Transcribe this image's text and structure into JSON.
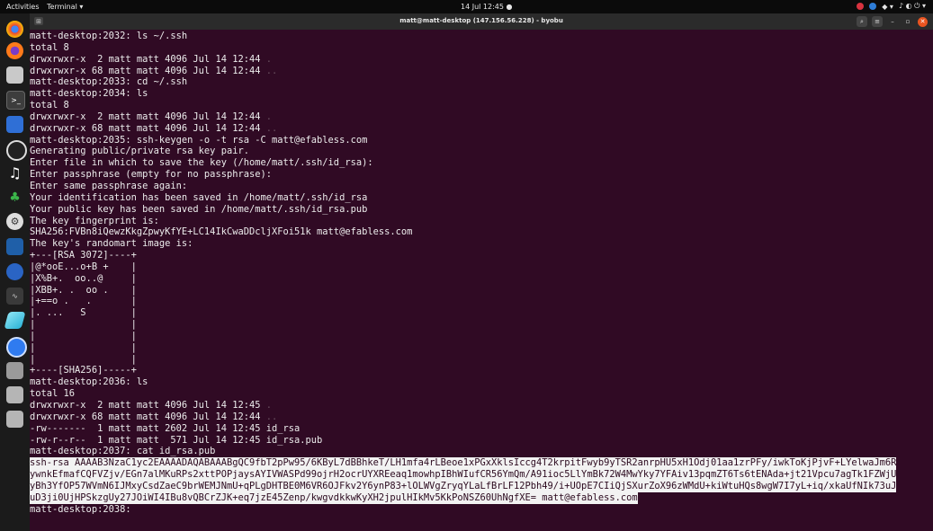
{
  "topbar": {
    "activities": "Activities",
    "app_menu": "Terminal ▾",
    "clock": "14 Jul  12:45  ●",
    "status": [
      "▾",
      "⚲",
      "◆ ▾",
      "♪ ◐ ⏻ ▾"
    ]
  },
  "window": {
    "title": "matt@matt-desktop (147.156.56.228) - byobu",
    "new_tab": "⊞",
    "search": "⌕",
    "menu": "≡",
    "minimize": "–",
    "maximize": "▫",
    "close": "✕"
  },
  "dock": {
    "items": [
      "chrome-icon",
      "firefox-icon",
      "files-icon",
      "terminal-icon",
      "screenshot-icon",
      "obs-icon",
      "music-icon",
      "plant-icon",
      "settings-icon",
      "vscode-icon",
      "davinci-icon",
      "monitor-icon",
      "eraser-icon",
      "circle-app-icon",
      "drive-icon",
      "usb-icon",
      "usb-icon-2"
    ]
  },
  "terminal": {
    "lines": [
      "matt-desktop:2032: ls ~/.ssh",
      "total 8",
      "drwxrwxr-x  2 matt matt 4096 Jul 14 12:44 ",
      "drwxrwxr-x 68 matt matt 4096 Jul 14 12:44 ",
      "matt-desktop:2033: cd ~/.ssh",
      "matt-desktop:2034: ls",
      "total 8",
      "drwxrwxr-x  2 matt matt 4096 Jul 14 12:44 ",
      "drwxrwxr-x 68 matt matt 4096 Jul 14 12:44 ",
      "matt-desktop:2035: ssh-keygen -o -t rsa -C matt@efabless.com",
      "Generating public/private rsa key pair.",
      "Enter file in which to save the key (/home/matt/.ssh/id_rsa):",
      "Enter passphrase (empty for no passphrase):",
      "Enter same passphrase again:",
      "Your identification has been saved in /home/matt/.ssh/id_rsa",
      "Your public key has been saved in /home/matt/.ssh/id_rsa.pub",
      "The key fingerprint is:",
      "SHA256:FVBn8iQewzKkgZpwyKfYE+LC14IkCwaDDcljXFoi51k matt@efabless.com",
      "The key's randomart image is:",
      "+---[RSA 3072]----+",
      "|@*ooE...o+B +    |",
      "|X%B+.  oo..@     |",
      "|XBB+. .  oo .    |",
      "|+==o .   .       |",
      "|. ...   S        |",
      "|                 |",
      "|                 |",
      "|                 |",
      "|                 |",
      "+----[SHA256]-----+",
      "matt-desktop:2036: ls",
      "total 16",
      "drwxrwxr-x  2 matt matt 4096 Jul 14 12:45 ",
      "drwxrwxr-x 68 matt matt 4096 Jul 14 12:44 ",
      "-rw-------  1 matt matt 2602 Jul 14 12:45 id_rsa",
      "-rw-r--r--  1 matt matt  571 Jul 14 12:45 id_rsa.pub",
      "matt-desktop:2037: cat id_rsa.pub"
    ],
    "dir_dots": [
      ".",
      "..",
      ".",
      "..",
      ".",
      ".."
    ],
    "pubkey_lines": [
      "ssh-rsa AAAAB3NzaC1yc2EAAAADAQABAAABgQC9fbT2pPw95/6KByL7dBBhkeT/LH1mfa4rLBeoe1xPGxXklsIccg4T2krpitFwyb9yTSR2anrpHU5xH1Odj01aa1zrPFy/iwkToKjPjvF+LYelwaJm6R",
      "ywnkEfmafCQFVZjv/EGn7alMKuRPs2xttPOPjaysAYIVWASPd99ojrH2ocrUYXREeaq1mowhpIBhWIufCR56YmQm/A91ioc5LlYmBk72W4MwYky7YFAiv13pqmZT6Ts6tENAda+jt21Vpcu7agTk1FZWjU",
      "yBh3YfOP57WVmN6IJMxyCsdZaeC9brWEMJNmU+qPLgDHTBE0M6VR6OJFkv2Y6ynP83+lOLWVgZryqYLaLfBrLF12Pbh49/i+UOpE7CIiQjSXurZoX96zWMdU+kiWtuHQs8wgW7I7yL+iq/xkaUfNIk73uJ",
      "uD3ji0UjHPSkzgUy27JOiWI4IBu8vQBCrZJK+eq7jzE45Zenp/kwgvdkkwKyXH2jpulHIkMv5KkPoNSZ60UhNgfXE= matt@efabless.com"
    ],
    "prompt": "matt-desktop:2038: "
  }
}
